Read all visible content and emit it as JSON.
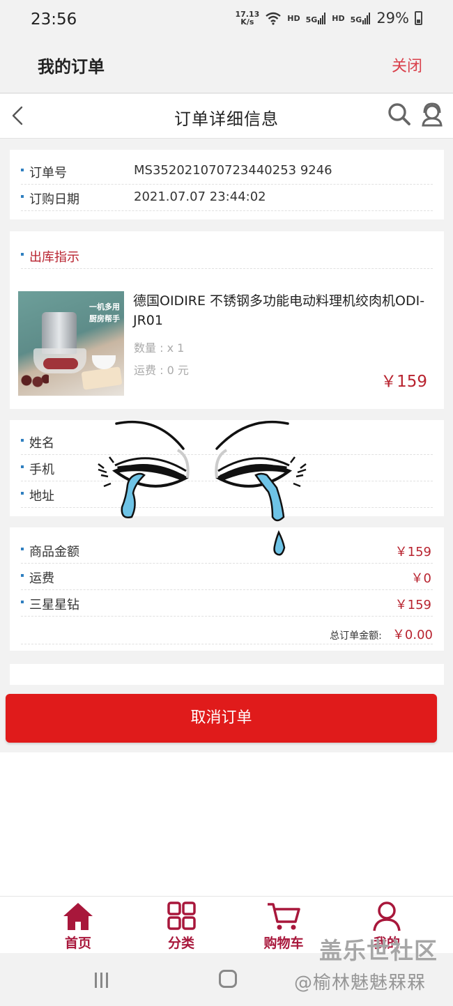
{
  "status_bar": {
    "time": "23:56",
    "net_speed_value": "17.13",
    "net_speed_unit": "K/s",
    "hd1": "HD",
    "sig1": "5G",
    "hd2": "HD",
    "sig2": "5G",
    "battery": "29%"
  },
  "header": {
    "title": "我的订单",
    "close_label": "关闭"
  },
  "nav": {
    "title": "订单详细信息"
  },
  "order_info": {
    "rows": [
      {
        "label": "订单号",
        "value": "MS352021070723440253 9246"
      },
      {
        "label": "订购日期",
        "value": "2021.07.07 23:44:02"
      }
    ]
  },
  "shipment": {
    "section_title": "出库指示",
    "product": {
      "image_tag_line1": "一机多用",
      "image_tag_line2": "厨房帮手",
      "name": "德国OIDIRE 不锈钢多功能电动料理机绞肉机ODI-JR01",
      "qty": "数量 : x 1",
      "shipping": "运费 : 0 元",
      "price": "￥159"
    }
  },
  "recipient": {
    "name_label": "姓名",
    "phone_label": "手机",
    "address_label": "地址"
  },
  "amounts": {
    "rows": [
      {
        "label": "商品金额",
        "value": "￥159"
      },
      {
        "label": "运费",
        "value": "￥0"
      },
      {
        "label": "三星星钻",
        "value": "￥159"
      }
    ],
    "total_label": "总订单金额:",
    "total_value": "￥0.00"
  },
  "cancel_button": "取消订单",
  "tabs": [
    {
      "label": "首页",
      "icon": "home-icon"
    },
    {
      "label": "分类",
      "icon": "category-icon"
    },
    {
      "label": "购物车",
      "icon": "cart-icon"
    },
    {
      "label": "我的",
      "icon": "user-icon"
    }
  ],
  "watermark": {
    "line1": "盖乐世社区",
    "line2": "@榆林魅魅槑槑"
  },
  "colors": {
    "accent_red": "#e01b1b",
    "price_red": "#b8232f",
    "tab_red": "#a8173b",
    "bullet_blue": "#2f7fc0"
  }
}
